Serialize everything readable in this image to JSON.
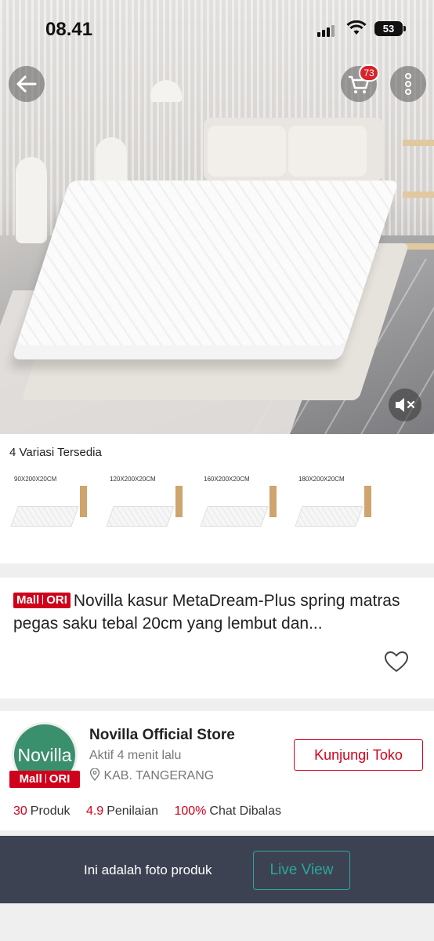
{
  "status_bar": {
    "time": "08.41",
    "battery": "53"
  },
  "header": {
    "cart_count": "73"
  },
  "variants": {
    "title": "4 Variasi Tersedia",
    "items": [
      {
        "label": "90X200X20CM"
      },
      {
        "label": "120X200X20CM"
      },
      {
        "label": "160X200X20CM"
      },
      {
        "label": "180X200X20CM"
      }
    ]
  },
  "product": {
    "badge_left": "Mall",
    "badge_right": "ORI",
    "title": "Novilla kasur MetaDream-Plus spring matras pegas saku tebal 20cm yang lembut dan..."
  },
  "store": {
    "avatar_text": "Novilla",
    "badge_left": "Mall",
    "badge_right": "ORI",
    "name": "Novilla Official Store",
    "active": "Aktif 4 menit lalu",
    "location": "KAB. TANGERANG",
    "visit_label": "Kunjungi Toko",
    "stats": [
      {
        "value": "30",
        "label": "Produk"
      },
      {
        "value": "4.9",
        "label": "Penilaian"
      },
      {
        "value": "100%",
        "label": "Chat Dibalas"
      }
    ]
  },
  "photo_bar": {
    "text": "Ini adalah foto produk",
    "button": "Live View"
  },
  "colors": {
    "accent": "#d0011b",
    "teal": "#2aa79b",
    "bar_bg": "#3c4252"
  }
}
